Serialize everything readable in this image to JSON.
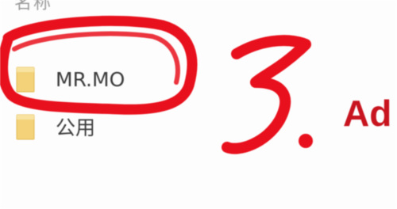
{
  "explorer": {
    "column_header": "名称",
    "items": [
      {
        "label": "MR.MO",
        "icon": "folder-icon"
      },
      {
        "label": "公用",
        "icon": "folder-icon"
      }
    ]
  },
  "annotation": {
    "step_number": "3.",
    "caption": "Ad",
    "color": "#e00b16"
  }
}
